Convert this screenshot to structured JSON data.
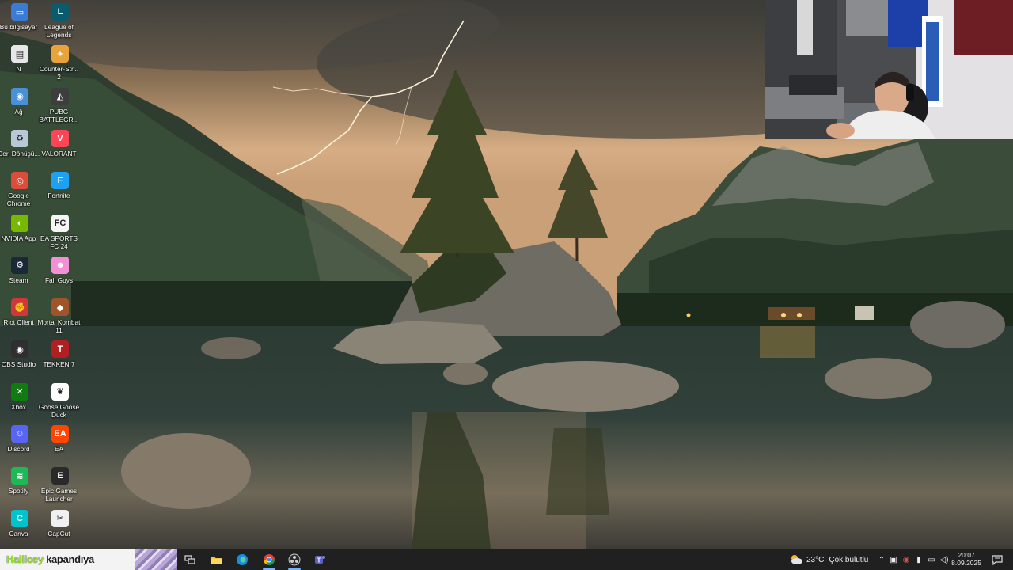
{
  "desktop": {
    "col1": [
      {
        "label": "Bu bilgisayar",
        "icon": "computer-icon",
        "color": "#3a7bd5",
        "glyph": "▭"
      },
      {
        "label": "N",
        "icon": "file-icon",
        "color": "#e7e7e7",
        "glyph": "▤"
      },
      {
        "label": "Ağ",
        "icon": "network-icon",
        "color": "#4a90d9",
        "glyph": "◉"
      },
      {
        "label": "Geri Dönüşü...",
        "icon": "recycle-bin-icon",
        "color": "#b9c7d6",
        "glyph": "♻"
      },
      {
        "label": "Google Chrome",
        "icon": "chrome-icon",
        "color": "#dd4b39",
        "glyph": "◎"
      },
      {
        "label": "NVIDIA App",
        "icon": "nvidia-icon",
        "color": "#76b900",
        "glyph": "◐"
      },
      {
        "label": "Steam",
        "icon": "steam-icon",
        "color": "#1b2838",
        "glyph": "⚙"
      },
      {
        "label": "Riot Client",
        "icon": "riot-client-icon",
        "color": "#d13639",
        "glyph": "✊"
      },
      {
        "label": "OBS Studio",
        "icon": "obs-icon",
        "color": "#302e31",
        "glyph": "◉"
      },
      {
        "label": "Xbox",
        "icon": "xbox-icon",
        "color": "#107c10",
        "glyph": "✕"
      },
      {
        "label": "Discord",
        "icon": "discord-icon",
        "color": "#5865f2",
        "glyph": "☺"
      },
      {
        "label": "Spotify",
        "icon": "spotify-icon",
        "color": "#1db954",
        "glyph": "≋"
      },
      {
        "label": "Canva",
        "icon": "canva-icon",
        "color": "#00c4cc",
        "glyph": "C"
      }
    ],
    "col2": [
      {
        "label": "League of Legends",
        "icon": "league-of-legends-icon",
        "color": "#0a5b6b",
        "glyph": "L"
      },
      {
        "label": "Counter-Str... 2",
        "icon": "counter-strike-icon",
        "color": "#e8a33d",
        "glyph": "✦"
      },
      {
        "label": "PUBG BATTLEGR...",
        "icon": "pubg-icon",
        "color": "#3d3d3d",
        "glyph": "◭"
      },
      {
        "label": "VALORANT",
        "icon": "valorant-icon",
        "color": "#fd4556",
        "glyph": "V"
      },
      {
        "label": "Fortnite",
        "icon": "fortnite-icon",
        "color": "#1da1f2",
        "glyph": "F"
      },
      {
        "label": "EA SPORTS FC 24",
        "icon": "ea-fc-icon",
        "color": "#f5f5f5",
        "glyph": "FC"
      },
      {
        "label": "Fall Guys",
        "icon": "fall-guys-icon",
        "color": "#f48fd6",
        "glyph": "☻"
      },
      {
        "label": "Mortal Kombat 11",
        "icon": "mortal-kombat-icon",
        "color": "#a0542c",
        "glyph": "◆"
      },
      {
        "label": "TEKKEN 7",
        "icon": "tekken-icon",
        "color": "#b02020",
        "glyph": "T"
      },
      {
        "label": "Goose Goose Duck",
        "icon": "goose-goose-duck-icon",
        "color": "#ffffff",
        "glyph": "❦"
      },
      {
        "label": "EA",
        "icon": "ea-icon",
        "color": "#ff4500",
        "glyph": "EA"
      },
      {
        "label": "Epic Games Launcher",
        "icon": "epic-games-icon",
        "color": "#2a2a2a",
        "glyph": "E"
      },
      {
        "label": "CapCut",
        "icon": "capcut-icon",
        "color": "#f0f0f0",
        "glyph": "✂"
      }
    ]
  },
  "taskbar": {
    "promo_part1": "Halilcey",
    "promo_part2": "kapandıya",
    "weather_temp": "23°C",
    "weather_desc": "Çok bulutlu",
    "time": "20:07",
    "date": "8.09.2025"
  }
}
